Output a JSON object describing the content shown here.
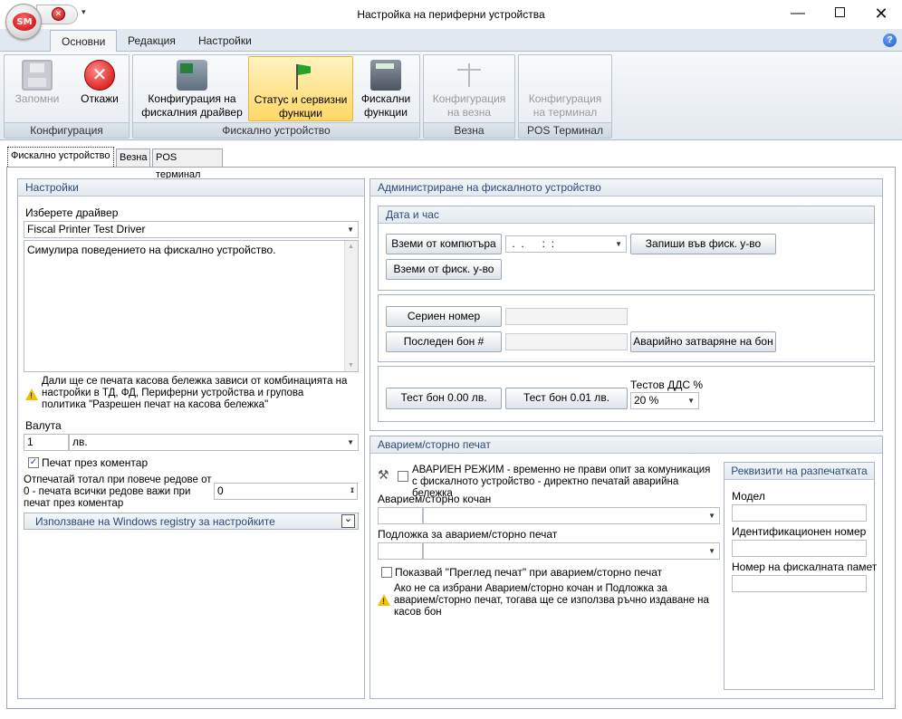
{
  "window": {
    "title": "Настройка на периферни устройства",
    "orb_text": "SM",
    "min_glyph": "—",
    "close_glyph": "✕",
    "qa_cancel_glyph": "✕",
    "qa_dropdown_glyph": "▾",
    "help_glyph": "?"
  },
  "ribbon": {
    "tabs": [
      {
        "label": "Основни"
      },
      {
        "label": "Редакция"
      },
      {
        "label": "Настройки"
      }
    ],
    "groups": {
      "configuration": "Конфигурация",
      "fiscal_device": "Фискално устройство",
      "scale": "Везна",
      "pos_terminal": "POS Терминал"
    },
    "buttons": {
      "save": "Запомни",
      "cancel": "Откажи",
      "driver_config_l1": "Конфигурация на",
      "driver_config_l2": "фискалния драйвер",
      "status_l1": "Статус и сервизни",
      "status_l2": "функции",
      "fiscal_fn_l1": "Фискални",
      "fiscal_fn_l2": "функции",
      "scale_cfg_l1": "Конфигурация",
      "scale_cfg_l2": "на везна",
      "term_cfg_l1": "Конфигурация",
      "term_cfg_l2": "на терминал"
    }
  },
  "page_tabs": [
    {
      "label": "Фискално устройство"
    },
    {
      "label": "Везна"
    },
    {
      "label": "POS терминал"
    }
  ],
  "settings": {
    "title": "Настройки",
    "driver_label": "Изберете драйвер",
    "driver_value": "Fiscal Printer Test Driver",
    "description": "Симулира поведението на фискално устройство.",
    "receipt_note": "Дали ще се печата касова бележка зависи от комбинацията на настройки в ТД, ФД, Периферни устройства и групова политика \"Разрешен печат на касова бележка\"",
    "currency_label": "Валута",
    "currency_code": "1",
    "currency_name": "лв.",
    "print_via_comment": "Печат през коментар",
    "print_total_label": "Отпечатай тотал при повече редове от 0 - печата всички редове важи при печат през коментар",
    "print_total_value": "0",
    "registry_label": "Използване на Windows registry за настройките"
  },
  "admin": {
    "title": "Администриране на фискалното устройство",
    "datetime": {
      "title": "Дата и час",
      "get_from_pc": "Вземи от компютъра",
      "datetime_value": " .  .      :  :",
      "write_to_device": "Запиши във фиск. у-во",
      "get_from_device": "Вземи от фиск. у-во"
    },
    "serial_number": "Сериен номер",
    "last_receipt": "Последен бон #",
    "emergency_close": "Аварийно затваряне на бон",
    "test_receipt_0": "Тест бон 0.00 лв.",
    "test_receipt_1": "Тест бон 0.01 лв.",
    "test_vat_label": "Тестов ДДС %",
    "test_vat_value": "20 %"
  },
  "emergency": {
    "title": "Аварием/сторно печат",
    "mode_label": "АВАРИЕН РЕЖИМ - временно не прави опит за комуникация с фискалното устройство - директно печатай аварийна бележка",
    "journal_label": "Аварием/сторно кочан",
    "paper_label": "Подложка за аварием/сторно печат",
    "preview_label": "Показвай \"Преглед печат\" при аварием/сторно печат",
    "note": "Ако не са избрани Аварием/сторно кочан и Подложка за аварием/сторно печат, тогава  ще се използва ръчно издаване на касов бон"
  },
  "printout": {
    "title": "Реквизити на разпечатката",
    "model_label": "Модел",
    "id_label": "Идентификационен номер",
    "fm_label": "Номер на фискалната памет"
  },
  "glyphs": {
    "check": "✓",
    "arrow_down": "▼",
    "spin_up": "▲",
    "spin_down": "▼",
    "expand": "⌄",
    "warn_bang": "!",
    "tools": "⚒"
  }
}
